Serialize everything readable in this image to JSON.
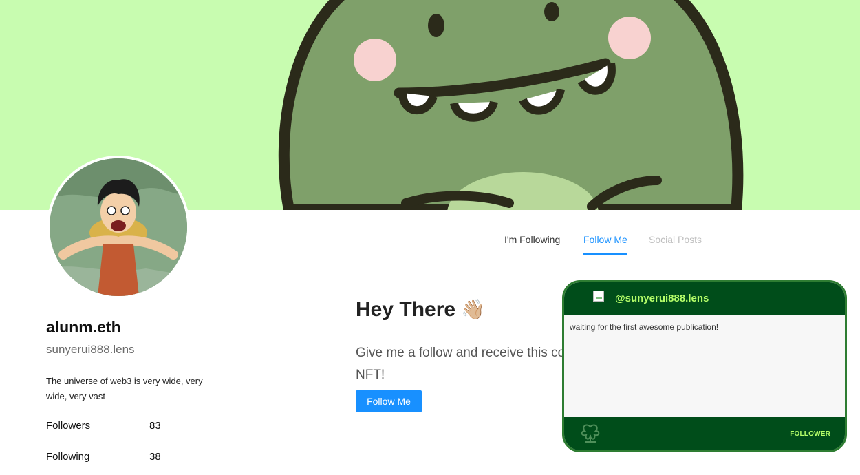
{
  "banner": {
    "background_color": "#c8fcb0",
    "character": "green-dinosaur-illustration"
  },
  "profile": {
    "name": "alunm.eth",
    "handle": "sunyerui888.lens",
    "bio": "The universe of web3 is very wide, very wide, very vast",
    "stats": {
      "followers_label": "Followers",
      "followers_value": "83",
      "following_label": "Following",
      "following_value": "38"
    }
  },
  "tabs": {
    "items": [
      {
        "label": "I'm Following",
        "active": false
      },
      {
        "label": "Follow Me",
        "active": true
      },
      {
        "label": "Social Posts",
        "active": false
      }
    ],
    "active_color": "#1890ff"
  },
  "content": {
    "heading": "Hey There",
    "heading_emoji": "👋🏼",
    "subtext": "Give me a follow and receive this cool NFT!",
    "follow_button": "Follow Me"
  },
  "nft_card": {
    "handle": "@sunyerui888.lens",
    "body_text": "waiting for the first awesome publication!",
    "footer_label": "FOLLOWER",
    "colors": {
      "header": "#004d1a",
      "accent": "#b6ff6a",
      "border": "#2e7d32"
    }
  }
}
